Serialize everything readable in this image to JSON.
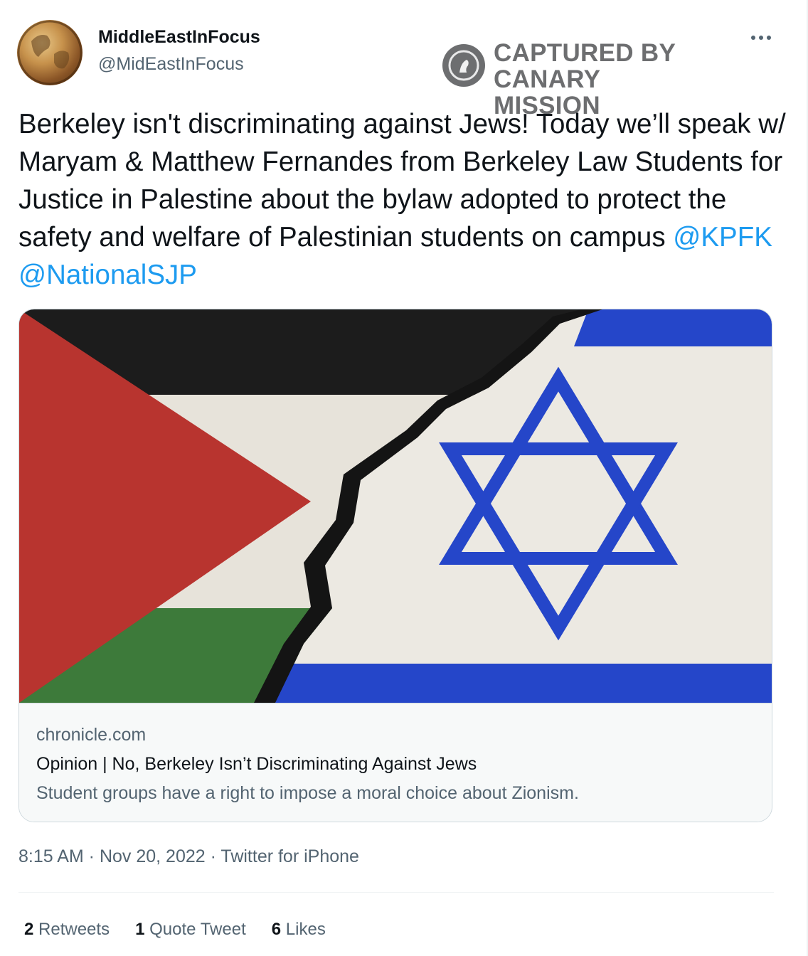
{
  "author": {
    "name": "MiddleEastInFocus",
    "handle": "@MidEastInFocus"
  },
  "more_icon": "more-horizontal-icon",
  "watermark": {
    "line1": "CAPTURED BY",
    "line2": "CANARY MISSION"
  },
  "tweet": {
    "text": "Berkeley isn't discriminating against Jews! Today we’ll speak w/ Maryam & Matthew Fernandes from Berkeley Law Students for Justice in Palestine about the bylaw adopted to protect the safety and welfare of Palestinian students on campus",
    "mentions": [
      "@KPFK",
      "@NationalSJP"
    ]
  },
  "card": {
    "domain": "chronicle.com",
    "title": "Opinion | No, Berkeley Isn’t Discriminating Against Jews",
    "description": "Student groups have a right to impose a moral choice about Zionism."
  },
  "meta": "8:15 AM · Nov 20, 2022 · Twitter for iPhone",
  "stats": [
    {
      "count": "2",
      "label": "Retweets"
    },
    {
      "count": "1",
      "label": "Quote Tweet"
    },
    {
      "count": "6",
      "label": "Likes"
    }
  ],
  "colors": {
    "link": "#1d9bf0",
    "secondary_text": "#536471",
    "palestine_red": "#b8342f",
    "palestine_green": "#3d7a3a",
    "israel_blue": "#2546c9"
  }
}
